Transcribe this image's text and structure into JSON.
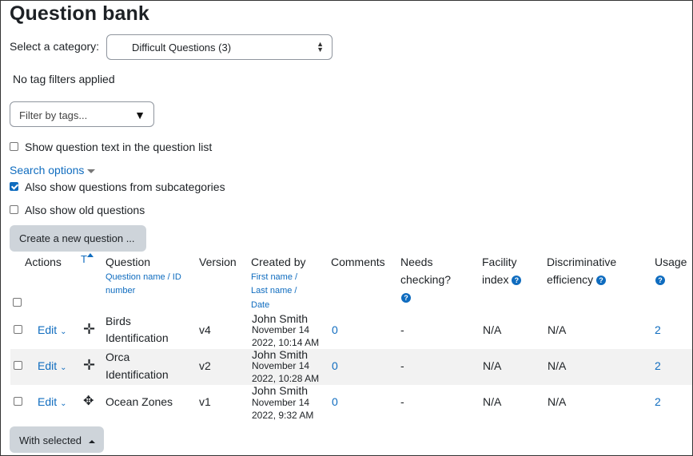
{
  "page": {
    "title": "Question bank",
    "category_label": "Select a category:",
    "category_value": "Difficult Questions (3)",
    "tag_status": "No tag filters applied",
    "tag_filter_placeholder": "Filter by tags...",
    "show_text_label": "Show question text in the question list",
    "search_options": "Search options",
    "subcategories_label": "Also show questions from subcategories",
    "old_questions_label": "Also show old questions",
    "create_button": "Create a new question ...",
    "with_selected": "With selected"
  },
  "table": {
    "headers": {
      "actions": "Actions",
      "type": "T",
      "question": "Question",
      "question_sub1": "Question name /",
      "question_sub2": "ID",
      "question_sub3": "number",
      "version": "Version",
      "created_by": "Created by",
      "created_sub1": "First name /",
      "created_sub2": "Last name /",
      "created_sub3": "Date",
      "comments": "Comments",
      "needs_checking1": "Needs",
      "needs_checking2": "checking?",
      "facility1": "Facility",
      "facility2": "index",
      "discrim1": "Discriminative",
      "discrim2": "efficiency",
      "usage": "Usage"
    },
    "rows": [
      {
        "edit": "Edit",
        "name1": "Birds",
        "name2": "Identification",
        "version": "v4",
        "author": "John Smith",
        "date1": "November 14",
        "date2": "2022, 10:14 AM",
        "comments": "0",
        "needs_checking": "-",
        "facility": "N/A",
        "discrim": "N/A",
        "usage": "2"
      },
      {
        "edit": "Edit",
        "name1": "Orca",
        "name2": "Identification",
        "version": "v2",
        "author": "John Smith",
        "date1": "November 14",
        "date2": "2022, 10:28 AM",
        "comments": "0",
        "needs_checking": "-",
        "facility": "N/A",
        "discrim": "N/A",
        "usage": "2"
      },
      {
        "edit": "Edit",
        "name1": "Ocean Zones",
        "name2": "",
        "version": "v1",
        "author": "John Smith",
        "date1": "November 14",
        "date2": "2022, 9:32 AM",
        "comments": "0",
        "needs_checking": "-",
        "facility": "N/A",
        "discrim": "N/A",
        "usage": "2"
      }
    ]
  },
  "icons": {
    "row1_type": "move-cross-icon",
    "row2_type": "move-cross-icon",
    "row3_type": "drag-and-drop-icon"
  },
  "colors": {
    "link": "#0f6cbf",
    "button_grey": "#ced4da",
    "stripe": "#f2f2f2"
  }
}
